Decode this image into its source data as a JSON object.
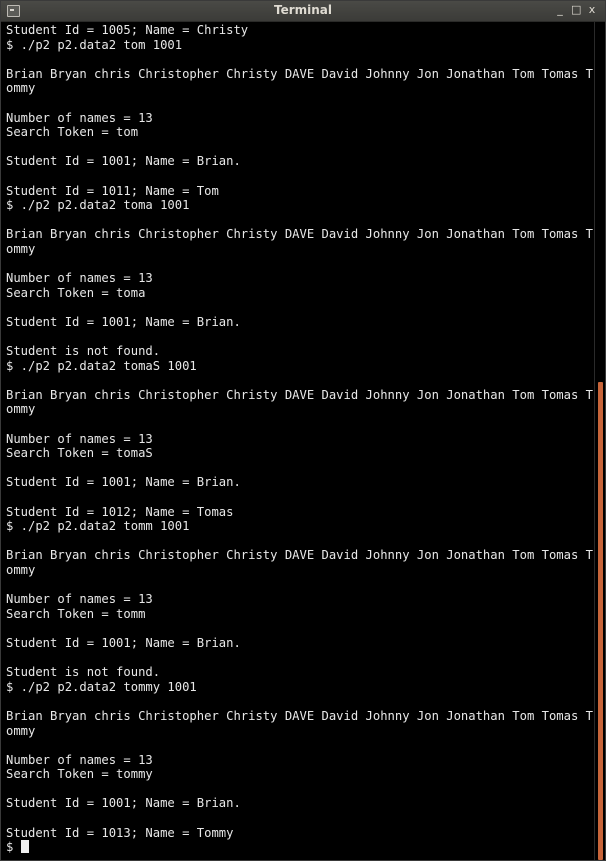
{
  "window": {
    "title": "Terminal",
    "icon": "terminal-app-icon",
    "controls": {
      "minimize": "_",
      "maximize": "□",
      "close": "x"
    }
  },
  "terminal": {
    "prompt": "$ ",
    "lines": [
      "Student Id = 1005; Name = Christy",
      "$ ./p2 p2.data2 tom 1001",
      "",
      "Brian Bryan chris Christopher Christy DAVE David Johnny Jon Jonathan Tom Tomas T",
      "ommy",
      "",
      "Number of names = 13",
      "Search Token = tom",
      "",
      "Student Id = 1001; Name = Brian.",
      "",
      "Student Id = 1011; Name = Tom",
      "$ ./p2 p2.data2 toma 1001",
      "",
      "Brian Bryan chris Christopher Christy DAVE David Johnny Jon Jonathan Tom Tomas T",
      "ommy",
      "",
      "Number of names = 13",
      "Search Token = toma",
      "",
      "Student Id = 1001; Name = Brian.",
      "",
      "Student is not found.",
      "$ ./p2 p2.data2 tomaS 1001",
      "",
      "Brian Bryan chris Christopher Christy DAVE David Johnny Jon Jonathan Tom Tomas T",
      "ommy",
      "",
      "Number of names = 13",
      "Search Token = tomaS",
      "",
      "Student Id = 1001; Name = Brian.",
      "",
      "Student Id = 1012; Name = Tomas",
      "$ ./p2 p2.data2 tomm 1001",
      "",
      "Brian Bryan chris Christopher Christy DAVE David Johnny Jon Jonathan Tom Tomas T",
      "ommy",
      "",
      "Number of names = 13",
      "Search Token = tomm",
      "",
      "Student Id = 1001; Name = Brian.",
      "",
      "Student is not found.",
      "$ ./p2 p2.data2 tommy 1001",
      "",
      "Brian Bryan chris Christopher Christy DAVE David Johnny Jon Jonathan Tom Tomas T",
      "ommy",
      "",
      "Number of names = 13",
      "Search Token = tommy",
      "",
      "Student Id = 1001; Name = Brian.",
      "",
      "Student Id = 1013; Name = Tommy"
    ]
  },
  "scrollbar": {
    "thumb_start_fraction": 0.43,
    "thumb_end_fraction": 1.0,
    "color": "#c8653a"
  }
}
